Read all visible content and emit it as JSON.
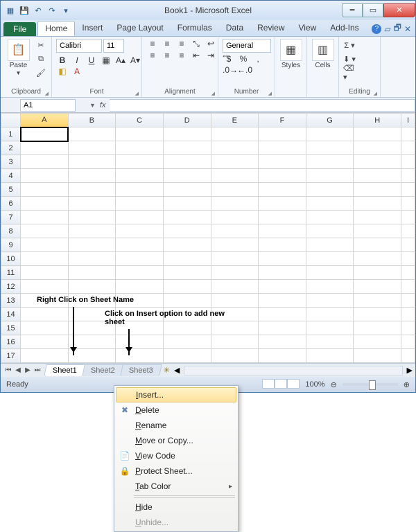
{
  "title": "Book1 - Microsoft Excel",
  "file_tab": "File",
  "tabs": [
    "Home",
    "Insert",
    "Page Layout",
    "Formulas",
    "Data",
    "Review",
    "View",
    "Add-Ins"
  ],
  "active_tab": "Home",
  "groups": {
    "clipboard": {
      "label": "Clipboard",
      "paste": "Paste"
    },
    "font": {
      "label": "Font",
      "name": "Calibri",
      "size": "11"
    },
    "alignment": {
      "label": "Alignment"
    },
    "number": {
      "label": "Number",
      "format": "General"
    },
    "styles": {
      "label": "Styles",
      "btn": "Styles"
    },
    "cells": {
      "label": "Cells",
      "btn": "Cells"
    },
    "editing": {
      "label": "Editing"
    }
  },
  "namebox": "A1",
  "columns": [
    "A",
    "B",
    "C",
    "D",
    "E",
    "F",
    "G",
    "H",
    "I"
  ],
  "rows": [
    "1",
    "2",
    "3",
    "4",
    "5",
    "6",
    "7",
    "8",
    "9",
    "10",
    "11",
    "12",
    "13",
    "14",
    "15",
    "16",
    "17"
  ],
  "selected_cell": "A1",
  "sheet_tabs": [
    "Sheet1",
    "Sheet2",
    "Sheet3"
  ],
  "status": {
    "ready": "Ready",
    "zoom": "100%"
  },
  "annotations": {
    "a1": "Right Click on Sheet Name",
    "a2": "Click on Insert option to add new sheet"
  },
  "context_menu": [
    {
      "label": "Insert...",
      "icon": "",
      "hl": true
    },
    {
      "label": "Delete",
      "icon": "✖"
    },
    {
      "label": "Rename",
      "icon": ""
    },
    {
      "label": "Move or Copy...",
      "icon": ""
    },
    {
      "label": "View Code",
      "icon": "📄"
    },
    {
      "label": "Protect Sheet...",
      "icon": "🔒"
    },
    {
      "label": "Tab Color",
      "icon": "",
      "sub": true
    },
    {
      "label": "Hide",
      "icon": ""
    },
    {
      "label": "Unhide...",
      "icon": "",
      "disabled": true
    }
  ],
  "context_underline": [
    "I",
    "D",
    "R",
    "M",
    "V",
    "P",
    "T",
    "H",
    "U"
  ]
}
